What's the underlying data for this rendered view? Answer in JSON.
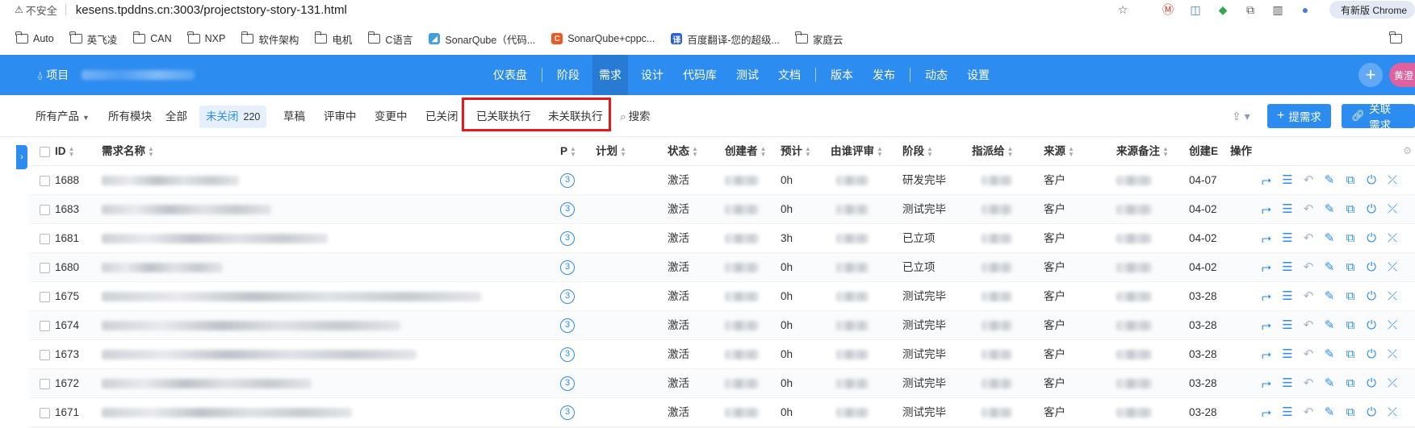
{
  "browser": {
    "insecure_label": "不安全",
    "url": "kesens.tpddns.cn:3003/projectstory-story-131.html",
    "update_label": "有新版 Chrome"
  },
  "bookmarks": [
    {
      "label": "Auto",
      "type": "folder"
    },
    {
      "label": "英飞凌",
      "type": "folder"
    },
    {
      "label": "CAN",
      "type": "folder"
    },
    {
      "label": "NXP",
      "type": "folder"
    },
    {
      "label": "软件架构",
      "type": "folder"
    },
    {
      "label": "电机",
      "type": "folder"
    },
    {
      "label": "C语言",
      "type": "folder"
    },
    {
      "label": "SonarQube（代码...",
      "type": "site",
      "color": "#3f9fdf"
    },
    {
      "label": "SonarQube+cppc...",
      "type": "site",
      "color": "#f05522"
    },
    {
      "label": "百度翻译-您的超级...",
      "type": "site",
      "color": "#2a62d9"
    },
    {
      "label": "家庭云",
      "type": "folder"
    }
  ],
  "header": {
    "project_label": "项目",
    "nav": [
      {
        "label": "仪表盘"
      },
      {
        "label": "阶段"
      },
      {
        "label": "需求",
        "active": true
      },
      {
        "label": "设计"
      },
      {
        "label": "代码库"
      },
      {
        "label": "测试"
      },
      {
        "label": "文档"
      },
      {
        "label": "版本"
      },
      {
        "label": "发布"
      },
      {
        "label": "动态"
      },
      {
        "label": "设置"
      }
    ],
    "avatar_text": "黄澄"
  },
  "filters": {
    "all_products": "所有产品",
    "all_modules": "所有模块",
    "all": "全部",
    "unclosed": "未关闭",
    "unclosed_count": "220",
    "draft": "草稿",
    "reviewing": "评审中",
    "changing": "变更中",
    "closed": "已关闭",
    "linked_exec": "已关联执行",
    "unlinked_exec": "未关联执行",
    "search": "搜索",
    "btn_add": "提需求",
    "btn_link": "关联需求"
  },
  "table": {
    "columns": [
      "ID",
      "需求名称",
      "P",
      "计划",
      "状态",
      "创建者",
      "预计",
      "由谁评审",
      "阶段",
      "指派给",
      "来源",
      "来源备注",
      "创建E",
      "操作"
    ],
    "rows": [
      {
        "id": "1688",
        "pri": "3",
        "status": "激活",
        "estimate": "0h",
        "stage": "研发完毕",
        "source": "客户",
        "date": "04-07"
      },
      {
        "id": "1683",
        "pri": "3",
        "status": "激活",
        "estimate": "0h",
        "stage": "测试完毕",
        "source": "客户",
        "date": "04-02"
      },
      {
        "id": "1681",
        "pri": "3",
        "status": "激活",
        "estimate": "3h",
        "stage": "已立项",
        "source": "客户",
        "date": "04-02"
      },
      {
        "id": "1680",
        "pri": "3",
        "status": "激活",
        "estimate": "0h",
        "stage": "已立项",
        "source": "客户",
        "date": "04-02"
      },
      {
        "id": "1675",
        "pri": "3",
        "status": "激活",
        "estimate": "0h",
        "stage": "测试完毕",
        "source": "客户",
        "date": "03-28"
      },
      {
        "id": "1674",
        "pri": "3",
        "status": "激活",
        "estimate": "0h",
        "stage": "测试完毕",
        "source": "客户",
        "date": "03-28"
      },
      {
        "id": "1673",
        "pri": "3",
        "status": "激活",
        "estimate": "0h",
        "stage": "测试完毕",
        "source": "客户",
        "date": "03-28"
      },
      {
        "id": "1672",
        "pri": "3",
        "status": "激活",
        "estimate": "0h",
        "stage": "测试完毕",
        "source": "客户",
        "date": "03-28"
      },
      {
        "id": "1671",
        "pri": "3",
        "status": "激活",
        "estimate": "0h",
        "stage": "测试完毕",
        "source": "客户",
        "date": "03-28"
      }
    ]
  },
  "colors": {
    "brand": "#2d8cf0",
    "highlight": "#e8171b",
    "avatar": "#e0619f"
  }
}
